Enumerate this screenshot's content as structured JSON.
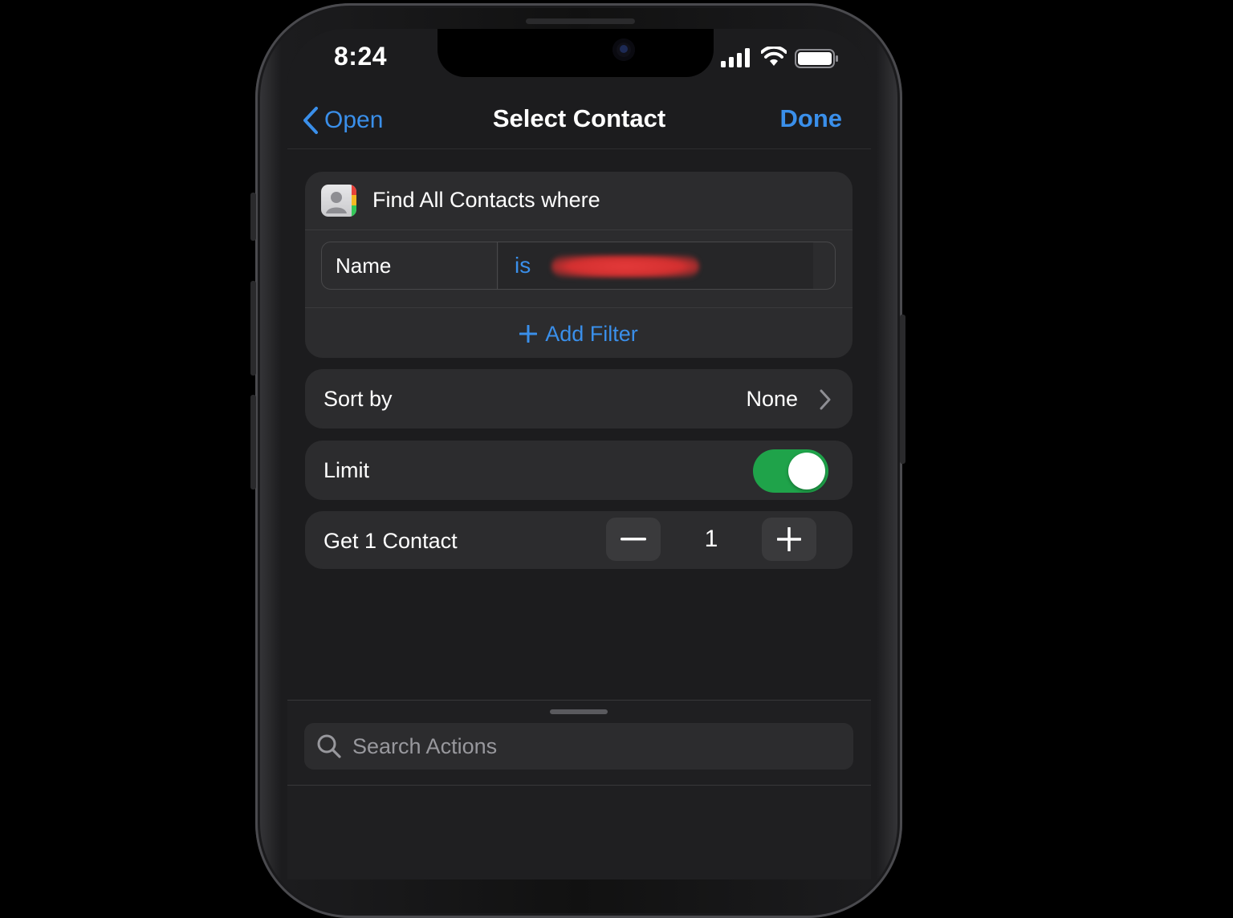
{
  "status_bar": {
    "time": "8:24",
    "icons": [
      "signal-icon",
      "wifi-icon",
      "battery-icon"
    ]
  },
  "nav": {
    "back_label": "Open",
    "title": "Select Contact",
    "done_label": "Done"
  },
  "action": {
    "icon": "contacts-app-icon",
    "title": "Find All Contacts where",
    "filter": {
      "field": "Name",
      "operator": "is",
      "value": ""
    },
    "add_filter_label": "Add Filter"
  },
  "sort": {
    "label": "Sort by",
    "value": "None"
  },
  "limit": {
    "label": "Limit",
    "enabled": true
  },
  "get": {
    "label": "Get 1 Contact",
    "count": "1"
  },
  "search": {
    "placeholder": "Search Actions"
  },
  "colors": {
    "accent": "#3a8fea",
    "toggle_on": "#1fa34a",
    "background": "#1c1c1e",
    "card": "#2c2c2e"
  }
}
